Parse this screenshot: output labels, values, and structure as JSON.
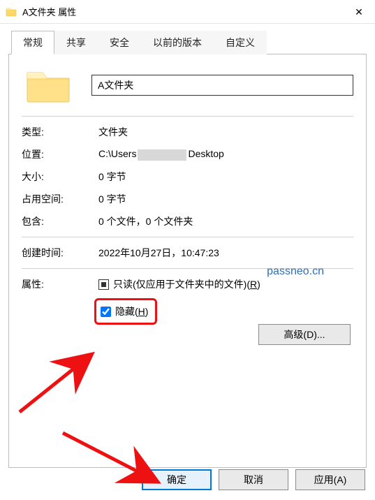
{
  "titlebar": {
    "title": "A文件夹 属性",
    "close_glyph": "✕"
  },
  "tabs": {
    "general": "常规",
    "share": "共享",
    "security": "安全",
    "prev": "以前的版本",
    "custom": "自定义"
  },
  "folder": {
    "name_value": "A文件夹"
  },
  "labels": {
    "type": "类型:",
    "location": "位置:",
    "size": "大小:",
    "size_on_disk": "占用空间:",
    "contains": "包含:",
    "created": "创建时间:",
    "attributes": "属性:"
  },
  "values": {
    "type": "文件夹",
    "location_prefix": "C:\\Users",
    "location_suffix": "Desktop",
    "size": "0 字节",
    "size_on_disk": "0 字节",
    "contains": "0 个文件，0 个文件夹",
    "created": "2022年10月27日，10:47:23"
  },
  "attrs": {
    "readonly_label_pre": "只读(仅应用于文件夹中的文件)(",
    "readonly_mnemonic": "R",
    "readonly_label_post": ")",
    "hidden_label_pre": "隐藏(",
    "hidden_mnemonic": "H",
    "hidden_label_post": ")",
    "advanced_pre": "高级(",
    "advanced_mnemonic": "D",
    "advanced_post": ")..."
  },
  "buttons": {
    "ok": "确定",
    "cancel": "取消",
    "apply_pre": "应用(",
    "apply_mnemonic": "A",
    "apply_post": ")"
  },
  "watermark": "passneo.cn"
}
